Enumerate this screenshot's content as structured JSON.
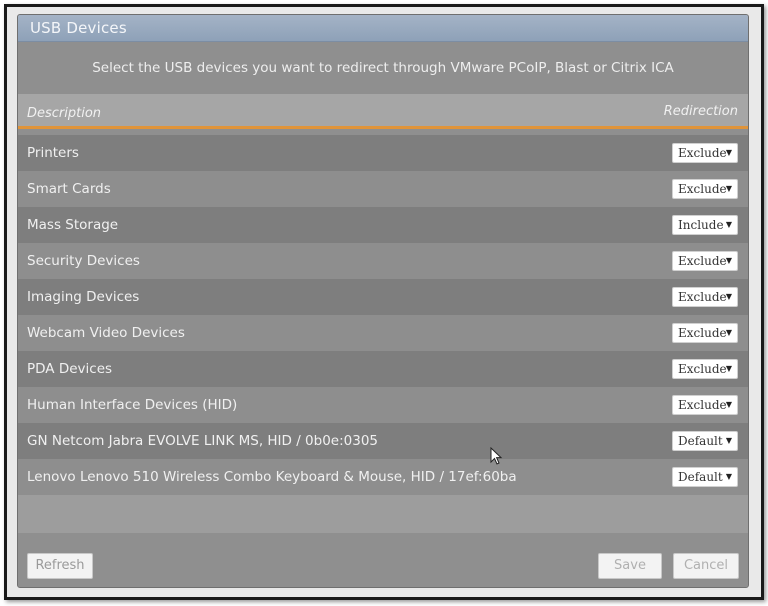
{
  "dialog": {
    "title": "USB Devices",
    "instructions": "Select the USB devices you want to redirect through VMware PCoIP, Blast or Citrix ICA"
  },
  "table": {
    "columns": {
      "description": "Description",
      "redirection": "Redirection"
    },
    "rows": [
      {
        "description": "Printers",
        "redirection": "Exclude"
      },
      {
        "description": "Smart Cards",
        "redirection": "Exclude"
      },
      {
        "description": "Mass Storage",
        "redirection": "Include"
      },
      {
        "description": "Security Devices",
        "redirection": "Exclude"
      },
      {
        "description": "Imaging Devices",
        "redirection": "Exclude"
      },
      {
        "description": "Webcam Video Devices",
        "redirection": "Exclude"
      },
      {
        "description": "PDA Devices",
        "redirection": "Exclude"
      },
      {
        "description": "Human Interface Devices (HID)",
        "redirection": "Exclude"
      },
      {
        "description": "GN Netcom Jabra EVOLVE LINK MS, HID / 0b0e:0305",
        "redirection": "Default"
      },
      {
        "description": "Lenovo Lenovo 510 Wireless Combo Keyboard & Mouse, HID / 17ef:60ba",
        "redirection": "Default"
      }
    ]
  },
  "buttons": {
    "refresh": "Refresh",
    "save": "Save",
    "cancel": "Cancel"
  },
  "colors": {
    "accent_divider": "#e0943a",
    "titlebar": "#8ea1b8"
  },
  "icons": {
    "dropdown": "chevron-down-icon",
    "cursor": "mouse-pointer-icon"
  }
}
